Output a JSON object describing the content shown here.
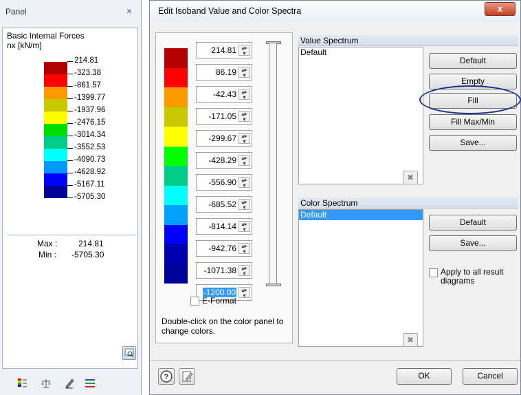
{
  "panel": {
    "title": "Panel",
    "close": "×",
    "heading": "Basic Internal Forces",
    "unit": "nx [kN/m]",
    "legend_values": [
      "214.81",
      "-323.38",
      "-861.57",
      "-1399.77",
      "-1937.96",
      "-2476.15",
      "-3014.34",
      "-3552.53",
      "-4090.73",
      "-4628.92",
      "-5167.11",
      "-5705.30"
    ],
    "legend_colors": [
      "#b10000",
      "#ff0000",
      "#ff9900",
      "#c8c800",
      "#ffff00",
      "#00dd00",
      "#00cc88",
      "#00ffff",
      "#0099ff",
      "#0000ff",
      "#000099"
    ],
    "max_label": "Max :",
    "max_value": "214.81",
    "min_label": "Min :",
    "min_value": "-5705.30"
  },
  "dialog": {
    "title": "Edit Isoband Value and Color Spectra",
    "close_symbol": "x",
    "spectrum_colors": [
      "#b40000",
      "#ff0000",
      "#ff9900",
      "#c8c800",
      "#ffff00",
      "#00ff00",
      "#00cc88",
      "#00ffff",
      "#00a0ff",
      "#0000ff",
      "#0000b0",
      "#00009a"
    ],
    "values": [
      "214.81",
      "86.19",
      "-42.43",
      "-171.05",
      "-299.67",
      "-428.29",
      "-556.90",
      "-685.52",
      "-814.14",
      "-942.76",
      "-1071.38",
      "-1200.00"
    ],
    "selected_value_index": 11,
    "eformat_label": "E-Format",
    "hint": "Double-click on the color panel to change colors.",
    "value_spectrum": {
      "title": "Value Spectrum",
      "items": [
        "Default"
      ],
      "buttons": [
        "Default",
        "Empty",
        "Fill",
        "Fill Max/Min",
        "Save..."
      ]
    },
    "color_spectrum": {
      "title": "Color Spectrum",
      "items": [
        "Default"
      ],
      "buttons": [
        "Default",
        "Save..."
      ],
      "apply_all_label": "Apply to all result diagrams"
    },
    "ok": "OK",
    "cancel": "Cancel"
  }
}
